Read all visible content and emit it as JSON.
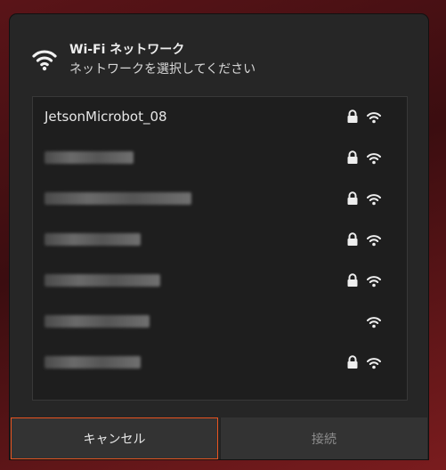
{
  "dialog": {
    "title": "Wi-Fi ネットワーク",
    "subtitle": "ネットワークを選択してください",
    "header_icon": "wifi-icon"
  },
  "networks": [
    {
      "ssid": "JetsonMicrobot_08",
      "secured": true,
      "signal_icon": "wifi-signal-icon",
      "redacted": false
    },
    {
      "ssid": "",
      "secured": true,
      "signal_icon": "wifi-signal-icon",
      "redacted": true
    },
    {
      "ssid": "",
      "secured": true,
      "signal_icon": "wifi-signal-icon",
      "redacted": true
    },
    {
      "ssid": "",
      "secured": true,
      "signal_icon": "wifi-signal-icon",
      "redacted": true
    },
    {
      "ssid": "",
      "secured": true,
      "signal_icon": "wifi-signal-icon",
      "redacted": true
    },
    {
      "ssid": "",
      "secured": false,
      "signal_icon": "wifi-signal-icon",
      "redacted": true
    },
    {
      "ssid": "",
      "secured": true,
      "signal_icon": "wifi-signal-icon",
      "redacted": true
    }
  ],
  "buttons": {
    "cancel": "キャンセル",
    "connect": "接続"
  },
  "colors": {
    "accent": "#e95420",
    "dialog_bg": "#262626",
    "list_bg": "#1e1e1e"
  }
}
